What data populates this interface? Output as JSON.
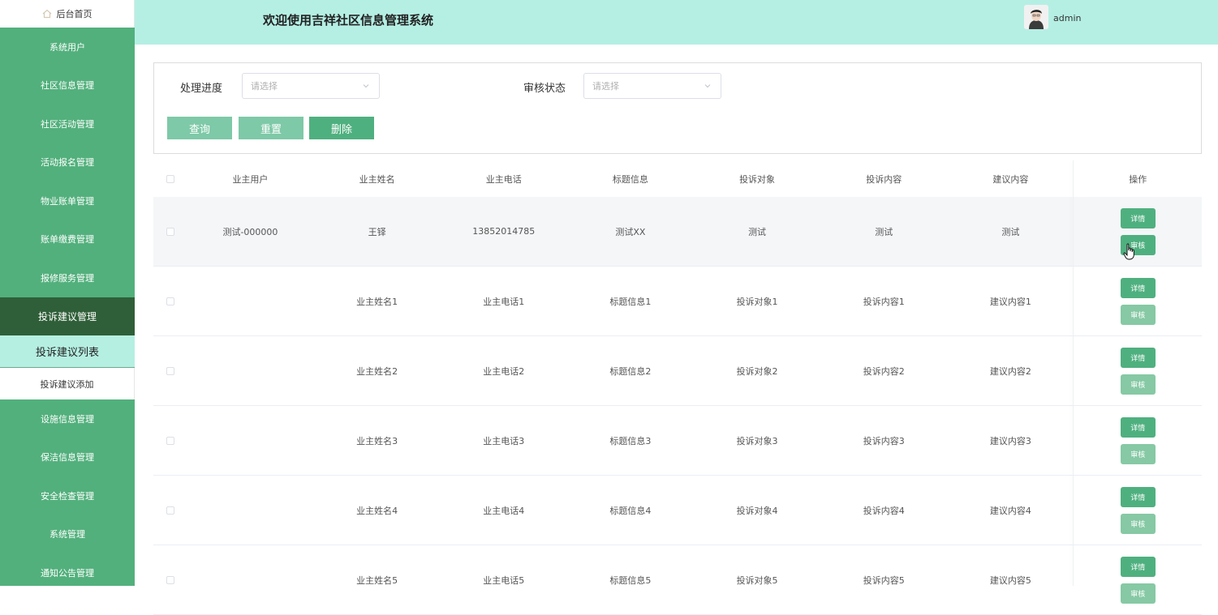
{
  "header": {
    "title": "欢迎使用吉祥社区信息管理系统",
    "user": "admin"
  },
  "sidebar": {
    "home": "后台首页",
    "items": [
      "系统用户",
      "社区信息管理",
      "社区活动管理",
      "活动报名管理",
      "物业账单管理",
      "账单缴费管理",
      "报修服务管理",
      "投诉建议管理"
    ],
    "sub_items": [
      "投诉建议列表",
      "投诉建议添加"
    ],
    "items_after": [
      "设施信息管理",
      "保洁信息管理",
      "安全检查管理",
      "系统管理",
      "通知公告管理"
    ]
  },
  "filter": {
    "progress_label": "处理进度",
    "progress_placeholder": "请选择",
    "audit_label": "审核状态",
    "audit_placeholder": "请选择",
    "query": "查询",
    "reset": "重置",
    "delete": "删除"
  },
  "table": {
    "headers": [
      "业主用户",
      "业主姓名",
      "业主电话",
      "标题信息",
      "投诉对象",
      "投诉内容",
      "建议内容",
      "操作"
    ],
    "rows": [
      [
        "测试-000000",
        "王铎",
        "13852014785",
        "测试XX",
        "测试",
        "测试",
        "测试"
      ],
      [
        "",
        "业主姓名1",
        "业主电话1",
        "标题信息1",
        "投诉对象1",
        "投诉内容1",
        "建议内容1"
      ],
      [
        "",
        "业主姓名2",
        "业主电话2",
        "标题信息2",
        "投诉对象2",
        "投诉内容2",
        "建议内容2"
      ],
      [
        "",
        "业主姓名3",
        "业主电话3",
        "标题信息3",
        "投诉对象3",
        "投诉内容3",
        "建议内容3"
      ],
      [
        "",
        "业主姓名4",
        "业主电话4",
        "标题信息4",
        "投诉对象4",
        "投诉内容4",
        "建议内容4"
      ],
      [
        "",
        "业主姓名5",
        "业主电话5",
        "标题信息5",
        "投诉对象5",
        "投诉内容5",
        "建议内容5"
      ]
    ],
    "detail_label": "详情",
    "audit_label": "审核"
  },
  "colors": {
    "sidebar": "#52b07c",
    "sidebar_active": "#2f5f38",
    "header": "#b5efe4",
    "button": "#4fb07f"
  }
}
